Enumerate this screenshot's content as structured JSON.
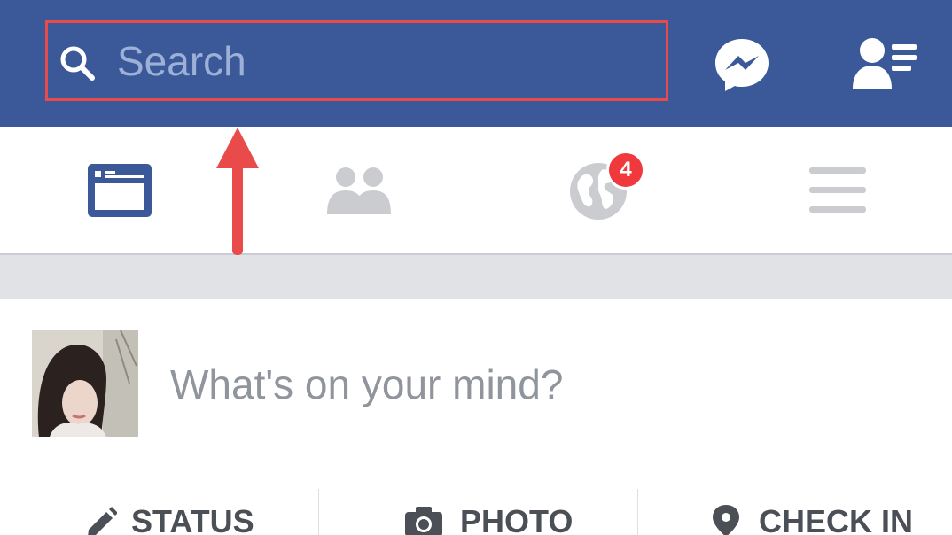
{
  "topbar": {
    "search_placeholder": "Search",
    "background_color": "#3b5998",
    "highlight_color": "#e94b4b",
    "messenger_icon": "messenger-icon",
    "friend_requests_icon": "friend-requests-icon"
  },
  "nav": {
    "items": [
      {
        "name": "news-feed",
        "icon": "news-feed-icon",
        "active": true
      },
      {
        "name": "friends",
        "icon": "friends-icon",
        "active": false
      },
      {
        "name": "notifications",
        "icon": "globe-icon",
        "active": false,
        "badge": "4"
      },
      {
        "name": "more",
        "icon": "menu-icon",
        "active": false
      }
    ],
    "active_color": "#3b5998",
    "inactive_color": "#cbccd0"
  },
  "composer": {
    "prompt": "What's on your mind?"
  },
  "actions": {
    "status_label": "STATUS",
    "photo_label": "PHOTO",
    "checkin_label": "CHECK IN"
  }
}
